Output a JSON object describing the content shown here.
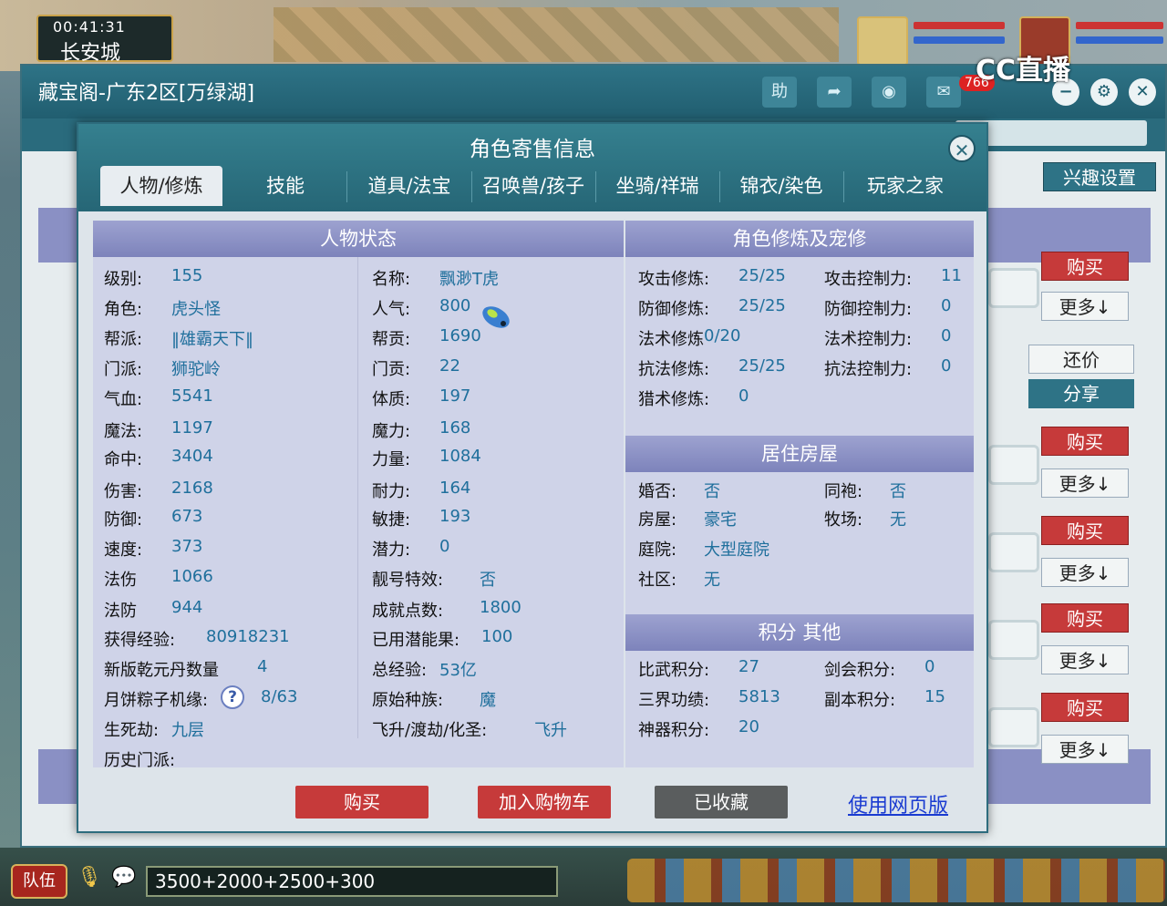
{
  "hud": {
    "time": "00:41:31",
    "city": "长安城"
  },
  "watermark": "CC直播",
  "shop": {
    "title": "藏宝阁-广东2区[万绿湖]",
    "badge": "766",
    "toolbar_help": "助",
    "interest_button": "兴趣设置",
    "side_buttons": [
      {
        "buy": "购买",
        "more": "更多↓"
      },
      {
        "buy": "购买",
        "more": "更多↓"
      },
      {
        "buy": "购买",
        "more": "更多↓"
      },
      {
        "buy": "购买",
        "more": "更多↓"
      },
      {
        "buy": "购买",
        "more": "更多↓"
      }
    ],
    "counter_offer": "还价",
    "share": "分享"
  },
  "modal": {
    "title": "角色寄售信息",
    "tabs": [
      "人物/修炼",
      "技能",
      "道具/法宝",
      "召唤兽/孩子",
      "坐骑/祥瑞",
      "锦衣/染色",
      "玩家之家"
    ],
    "status": {
      "header": "人物状态",
      "left": [
        {
          "label": "级别:",
          "value": "155"
        },
        {
          "label": "角色:",
          "value": "虎头怪"
        },
        {
          "label": "帮派:",
          "value": "‖雄霸天下‖"
        },
        {
          "label": "门派:",
          "value": "狮驼岭"
        },
        {
          "label": "气血:",
          "value": "5541"
        },
        {
          "label": "魔法:",
          "value": "1197"
        },
        {
          "label": "命中:",
          "value": "3404"
        },
        {
          "label": "伤害:",
          "value": "2168"
        },
        {
          "label": "防御:",
          "value": "673"
        },
        {
          "label": "速度:",
          "value": "373"
        },
        {
          "label": "法伤",
          "value": "1066"
        },
        {
          "label": "法防",
          "value": "944"
        },
        {
          "label": "获得经验:",
          "value": "80918231"
        },
        {
          "label": "新版乾元丹数量",
          "value": "4"
        },
        {
          "label": "月饼粽子机缘:",
          "value": "8/63"
        },
        {
          "label": "生死劫:",
          "value": "九层"
        },
        {
          "label": "历史门派:",
          "value": ""
        }
      ],
      "right": [
        {
          "label": "名称:",
          "value": "飘渺T虎"
        },
        {
          "label": "人气:",
          "value": "800"
        },
        {
          "label": "帮贡:",
          "value": "1690"
        },
        {
          "label": "门贡:",
          "value": "22"
        },
        {
          "label": "体质:",
          "value": "197"
        },
        {
          "label": "魔力:",
          "value": "168"
        },
        {
          "label": "力量:",
          "value": "1084"
        },
        {
          "label": "耐力:",
          "value": "164"
        },
        {
          "label": "敏捷:",
          "value": "193"
        },
        {
          "label": "潜力:",
          "value": "0"
        },
        {
          "label": "靓号特效:",
          "value": "否"
        },
        {
          "label": "成就点数:",
          "value": "1800"
        },
        {
          "label": "已用潜能果:",
          "value": "100"
        },
        {
          "label": "总经验:",
          "value": "53亿"
        },
        {
          "label": "原始种族:",
          "value": "魔"
        },
        {
          "label": "飞升/渡劫/化圣:",
          "value": "飞升"
        }
      ]
    },
    "cultivation": {
      "header": "角色修炼及宠修",
      "rows": [
        {
          "l1": "攻击修炼:",
          "v1": "25/25",
          "l2": "攻击控制力:",
          "v2": "11"
        },
        {
          "l1": "防御修炼:",
          "v1": "25/25",
          "l2": "防御控制力:",
          "v2": "0"
        },
        {
          "l1": "法术修炼",
          "v1": "0/20",
          "l2": "法术控制力:",
          "v2": "0"
        },
        {
          "l1": "抗法修炼:",
          "v1": "25/25",
          "l2": "抗法控制力:",
          "v2": "0"
        },
        {
          "l1": "猎术修炼:",
          "v1": "0",
          "l2": "",
          "v2": ""
        }
      ]
    },
    "house": {
      "header": "居住房屋",
      "rows": [
        {
          "l1": "婚否:",
          "v1": "否",
          "l2": "同袍:",
          "v2": "否"
        },
        {
          "l1": "房屋:",
          "v1": "豪宅",
          "l2": "牧场:",
          "v2": "无"
        },
        {
          "l1": "庭院:",
          "v1": "大型庭院",
          "l2": "",
          "v2": ""
        },
        {
          "l1": "社区:",
          "v1": "无",
          "l2": "",
          "v2": ""
        }
      ]
    },
    "points": {
      "header": "积分 其他",
      "rows": [
        {
          "l1": "比武积分:",
          "v1": "27",
          "l2": "剑会积分:",
          "v2": "0"
        },
        {
          "l1": "三界功绩:",
          "v1": "5813",
          "l2": "副本积分:",
          "v2": "15"
        },
        {
          "l1": "神器积分:",
          "v1": "20",
          "l2": "",
          "v2": ""
        }
      ]
    },
    "footer": {
      "buy": "购买",
      "add_cart": "加入购物车",
      "favorited": "已收藏",
      "web_link": "使用网页版"
    }
  },
  "bottom": {
    "team": "队伍",
    "chat_text": "3500+2000+2500+300"
  },
  "colors": {
    "accent": "#2e7386",
    "buy_red": "#c63a3a",
    "value_blue": "#1f6f9c",
    "section_purple": "#8a90c4"
  }
}
